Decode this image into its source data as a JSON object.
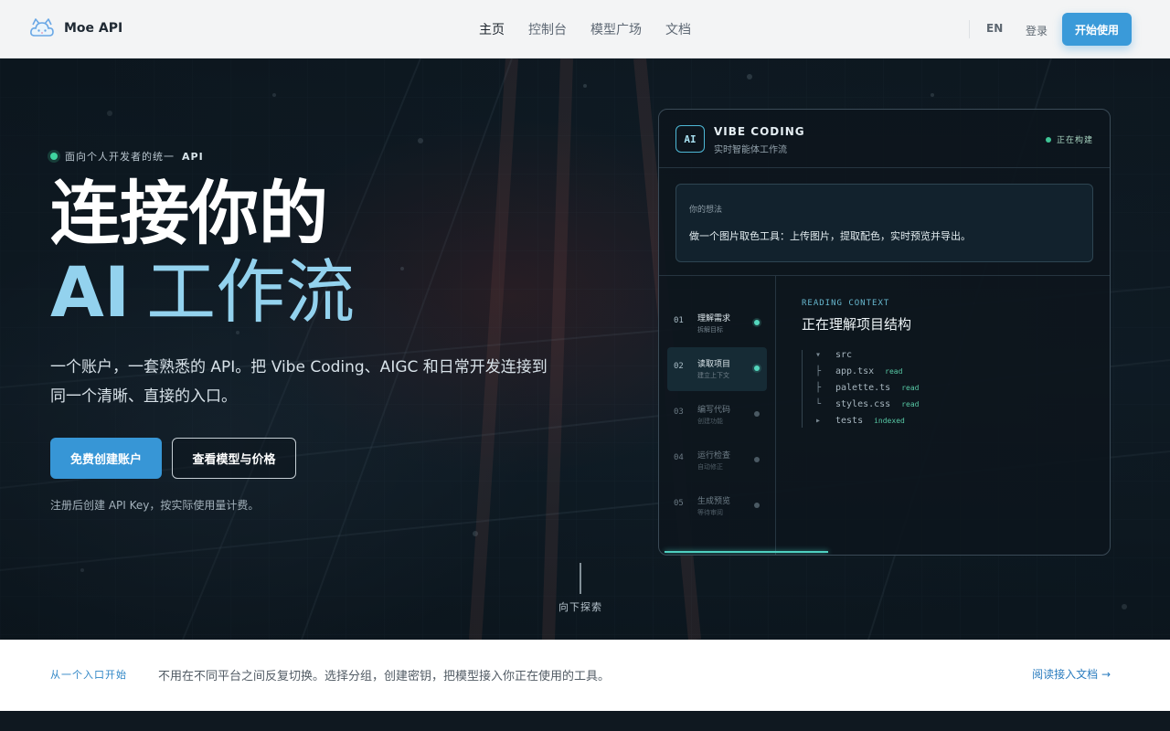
{
  "nav": {
    "brand": "Moe API",
    "links": [
      {
        "label": "主页",
        "active": true
      },
      {
        "label": "控制台",
        "active": false
      },
      {
        "label": "模型广场",
        "active": false
      },
      {
        "label": "文档",
        "active": false
      }
    ],
    "lang": "EN",
    "login": "登录",
    "cta": "开始使用"
  },
  "hero": {
    "eyebrow_prefix": "面向个人开发者的统一",
    "eyebrow_em": "API",
    "title_line1": "连接你的",
    "title_line2_strong": "AI",
    "title_line2_light": "工作流",
    "lead_line1": "一个账户，一套熟悉的 API。把 Vibe Coding、AIGC 和日常开发连接到",
    "lead_line2": "同一个清晰、直接的入口。",
    "primary_button": "免费创建账户",
    "secondary_button": "查看模型与价格",
    "note": "注册后创建 API Key，按实际使用量计费。",
    "scroll_label": "向下探索"
  },
  "panel": {
    "badge": "AI",
    "title": "VIBE CODING",
    "subtitle": "实时智能体工作流",
    "status": "正在构建",
    "idea_label": "你的想法",
    "idea_text": "做一个图片取色工具：上传图片，提取配色，实时预览并导出。",
    "steps": [
      {
        "num": "01",
        "title": "理解需求",
        "desc": "拆解目标",
        "state": "done"
      },
      {
        "num": "02",
        "title": "读取项目",
        "desc": "建立上下文",
        "state": "active"
      },
      {
        "num": "03",
        "title": "编写代码",
        "desc": "创建功能",
        "state": "pending"
      },
      {
        "num": "04",
        "title": "运行检查",
        "desc": "自动修正",
        "state": "pending"
      },
      {
        "num": "05",
        "title": "生成预览",
        "desc": "等待审阅",
        "state": "pending"
      }
    ],
    "context_label": "READING CONTEXT",
    "context_title": "正在理解项目结构",
    "tree": [
      {
        "glyph": "▾",
        "name": "src",
        "tag": ""
      },
      {
        "glyph": "├",
        "name": "app.tsx",
        "tag": "read"
      },
      {
        "glyph": "├",
        "name": "palette.ts",
        "tag": "read"
      },
      {
        "glyph": "└",
        "name": "styles.css",
        "tag": "read"
      },
      {
        "glyph": "▸",
        "name": "tests",
        "tag": "indexed"
      }
    ]
  },
  "band": {
    "kicker": "从一个入口开始",
    "text": "不用在不同平台之间反复切换。选择分组，创建密钥，把模型接入你正在使用的工具。",
    "link": "阅读接入文档 →"
  },
  "colors": {
    "accent": "#3a9ad9",
    "title_light": "#93d2ee",
    "status_green": "#3fc495",
    "hero_bg": "#12212c"
  }
}
